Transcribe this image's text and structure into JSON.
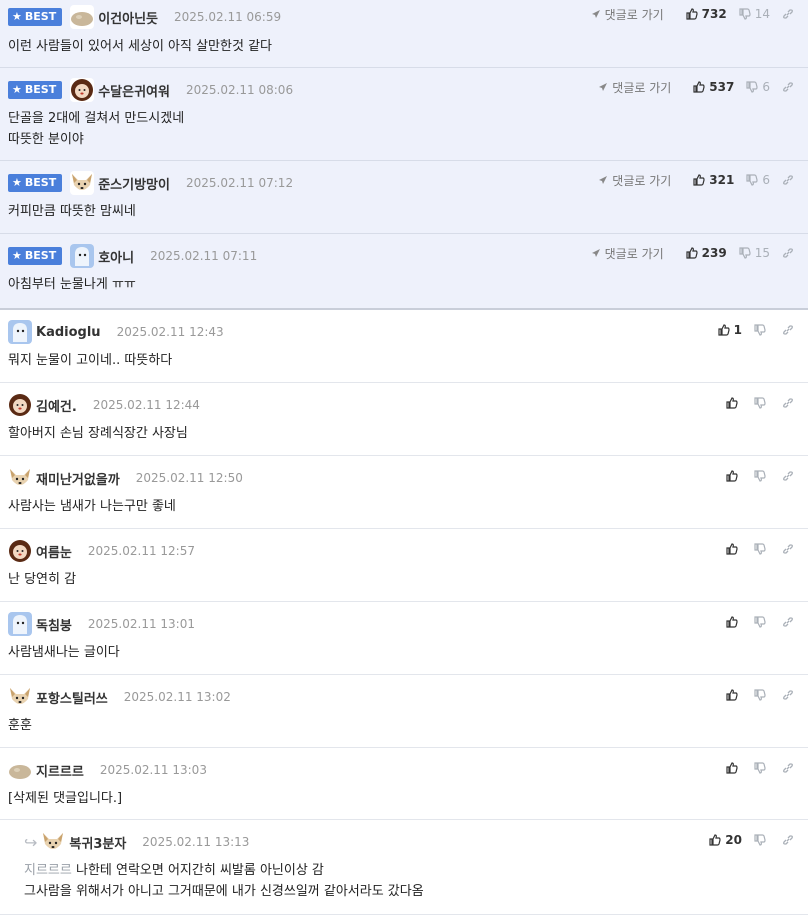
{
  "best_label": "BEST",
  "goto_label": "댓글로 가기",
  "comments": [
    {
      "nick": "이건아닌듯",
      "date": "2025.02.11 06:59",
      "text": [
        "이런 사람들이 있어서 세상이 아직 살만한것 같다"
      ],
      "up": "732",
      "down": "14",
      "best": true,
      "avatar": "potato"
    },
    {
      "nick": "수달은귀여워",
      "date": "2025.02.11 08:06",
      "text": [
        "단골을 2대에 걸쳐서 만드시겠네",
        "따뜻한 분이야"
      ],
      "up": "537",
      "down": "6",
      "best": true,
      "avatar": "lion"
    },
    {
      "nick": "준스기방망이",
      "date": "2025.02.11 07:12",
      "text": [
        "커피만큼 따뜻한 맘씨네"
      ],
      "up": "321",
      "down": "6",
      "best": true,
      "avatar": "dog"
    },
    {
      "nick": "호아니",
      "date": "2025.02.11 07:11",
      "text": [
        "아침부터 눈물나게 ㅠㅠ"
      ],
      "up": "239",
      "down": "15",
      "best": true,
      "avatar": "ghost"
    },
    {
      "nick": "Kadioglu",
      "date": "2025.02.11 12:43",
      "text": [
        "뭐지 눈물이 고이네.. 따뜻하다"
      ],
      "up": "1",
      "down": "",
      "best": false,
      "avatar": "ghost"
    },
    {
      "nick": "김예건.",
      "date": "2025.02.11 12:44",
      "text": [
        "할아버지 손님 장례식장간 사장님"
      ],
      "up": "",
      "down": "",
      "best": false,
      "avatar": "lion"
    },
    {
      "nick": "재미난거없을까",
      "date": "2025.02.11 12:50",
      "text": [
        "사람사는 냄새가 나는구만 좋네"
      ],
      "up": "",
      "down": "",
      "best": false,
      "avatar": "dog"
    },
    {
      "nick": "여름눈",
      "date": "2025.02.11 12:57",
      "text": [
        "난 당연히 감"
      ],
      "up": "",
      "down": "",
      "best": false,
      "avatar": "lion"
    },
    {
      "nick": "독침붕",
      "date": "2025.02.11 13:01",
      "text": [
        "사람냄새나는 글이다"
      ],
      "up": "",
      "down": "",
      "best": false,
      "avatar": "ghost"
    },
    {
      "nick": "포항스틸러쓰",
      "date": "2025.02.11 13:02",
      "text": [
        "훈훈"
      ],
      "up": "",
      "down": "",
      "best": false,
      "avatar": "dog"
    },
    {
      "nick": "지르르르",
      "date": "2025.02.11 13:03",
      "text": [
        "[삭제된 댓글입니다.]"
      ],
      "up": "",
      "down": "",
      "best": false,
      "avatar": "potato"
    }
  ],
  "reply": {
    "nick": "복귀3분자",
    "date": "2025.02.11 13:13",
    "mention": "지르르르",
    "text": [
      "나한테 연락오면 어지간히 씨발롬 아닌이상 감",
      "그사람을 위해서가 아니고 그거때문에 내가 신경쓰일꺼 같아서라도 갔다옴"
    ],
    "up": "20",
    "avatar": "dog"
  },
  "colors": {
    "best_bg": "#eef1fb",
    "badge": "#4a7fdb"
  }
}
